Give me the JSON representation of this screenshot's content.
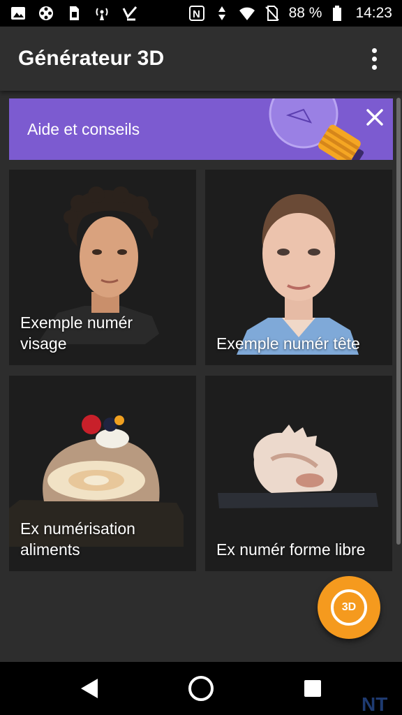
{
  "status_bar": {
    "battery": "88 %",
    "time": "14:23",
    "left_icons": [
      "image-icon",
      "film-reel-icon",
      "sim-icon",
      "wifi-broadcast-icon",
      "check-flag-icon"
    ],
    "right_icons": [
      "nfc-icon",
      "data-arrows-icon",
      "wifi-icon",
      "no-sim-icon",
      "battery-icon"
    ]
  },
  "app_bar": {
    "title": "Générateur 3D",
    "overflow_icon": "more-vert-icon"
  },
  "banner": {
    "text": "Aide et conseils",
    "close_icon": "close-icon",
    "illustration": "lightbulb-icon",
    "color": "#7c5bd0"
  },
  "cards": [
    {
      "label": "Exemple numér\nvisage",
      "image": "scanned-face-male"
    },
    {
      "label": "Exemple numér tête",
      "image": "scanned-head-female"
    },
    {
      "label": "Ex numérisation\naliments",
      "image": "scanned-cake-roll"
    },
    {
      "label": "Ex numér forme libre",
      "image": "scanned-seashell"
    }
  ],
  "fab": {
    "label": "3D",
    "icon": "camera-shutter-icon",
    "color": "#f59a1e"
  },
  "nav_bar": {
    "back_icon": "back-triangle-icon",
    "home_icon": "home-circle-icon",
    "recent_icon": "recents-square-icon",
    "watermark": "NT"
  }
}
